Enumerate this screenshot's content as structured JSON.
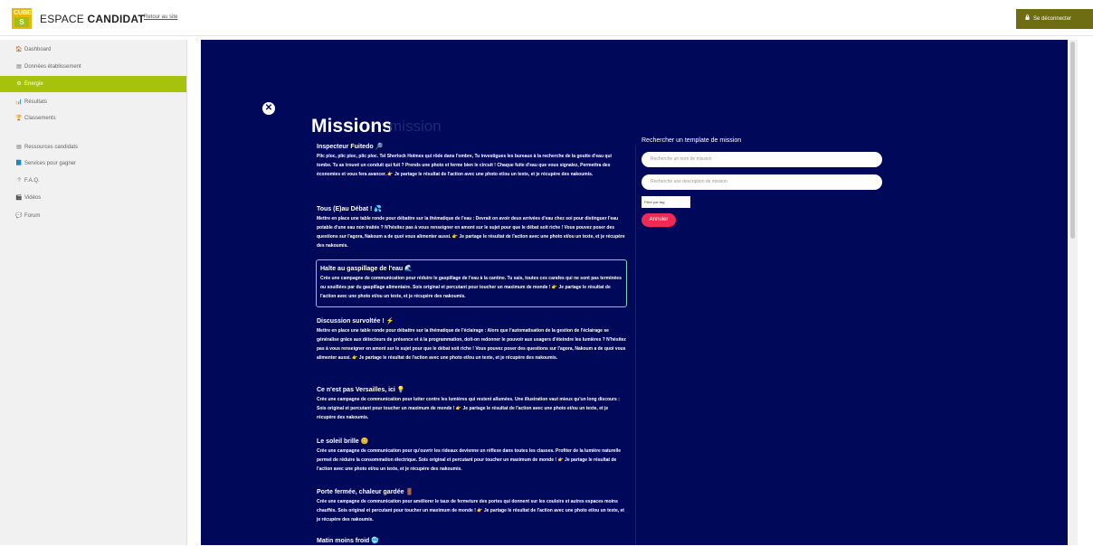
{
  "header": {
    "logo_top": "CUBE",
    "logo_bottom": "S",
    "brand_light": "ESPACE ",
    "brand_bold": "CANDIDAT",
    "back_link": "Retour au site",
    "logout_label": "Se déconnecter"
  },
  "sidebar": {
    "items": [
      {
        "icon": "🏠",
        "label": "Dashboard"
      },
      {
        "icon": "▤",
        "label": "Données établissement"
      },
      {
        "icon": "⚙",
        "label": "Energie"
      },
      {
        "icon": "📊",
        "label": "Résultats"
      },
      {
        "icon": "🏆",
        "label": "Classements"
      },
      {
        "icon": "▤",
        "label": "Ressources candidats"
      },
      {
        "icon": "📘",
        "label": "Services pour gagner"
      },
      {
        "icon": "?",
        "label": "F.A.Q."
      },
      {
        "icon": "🎬",
        "label": "Vidéos"
      },
      {
        "icon": "💬",
        "label": "Forum"
      }
    ]
  },
  "main": {
    "close": "✕",
    "title": "Missions",
    "title_ghost": "mission",
    "missions": [
      {
        "title": "Inspecteur Fuitedo 🔎",
        "desc": "Plic ploc, plic ploc, plic ploc. Tel Sherlock Holmes qui rôde dans l'ombre, Tu investigues les bureaux à la recherche de la goutte d'eau qui tombe. Tu as trouvé un conduit qui fuit ? Prends une photo et ferme bien le circuit ! Chaque fuite d'eau que vous signalez, Permettra des économies et vous fera avancer. 👉 Je partage le résultat de l'action avec une photo et/ou un texte, et je récupère des nakoumis."
      },
      {
        "title": "Tous (E)au Débat ! 💦",
        "desc": "Mettre en place une table ronde pour débattre sur la thématique de l'eau : Devrait on avoir deux arrivées d'eau chez soi pour distinguer l'eau potable d'une eau non traitée ? N'hésitez pas à vous renseigner en amont sur le sujet pour que le débat soit riche ! Vous pouvez poser des questions sur l'agora, Nakoum a de quoi vous alimenter aussi. 👉 Je partage le résultat de l'action avec une photo et/ou un texte, et je récupère des nakoumis."
      },
      {
        "title": "Halte au gaspillage de l'eau 🌊",
        "desc": "Crée une campagne de communication pour réduire le gaspillage de l'eau à la cantine. Tu sais, toutes ces carafes qui ne sont pas terminées ou souillées par du gaspillage alimentaire. Sois original et percutant pour toucher un maximum de monde ! 👉 Je partage le résultat de l'action avec une photo et/ou un texte, et je récupère des nakoumis."
      },
      {
        "title": "Discussion survoltée ! ⚡",
        "desc": "Mettre en place une table ronde pour débattre sur la thématique de l'éclairage : Alors que l'automatisation de la gestion de l'éclairage se généralise grâce aux détecteurs de présence et à la programmation, doit-on redonner le pouvoir aux usagers d'éteindre les lumières ? N'hésitez pas à vous renseigner en amont sur le sujet pour que le débat soit riche ! Vous pouvez poser des questions sur l'agora, Nakoum a de quoi vous alimenter aussi. 👉 Je partage le résultat de l'action avec une photo et/ou un texte, et je récupère des nakoumis."
      },
      {
        "title": "Ce n'est pas Versailles, ici 💡",
        "desc": "Crée une campagne de communication pour lutter contre les lumières qui restent allumées. Une illustration vaut mieux qu'un long discours : Sois original et percutant pour toucher un maximum de monde ! 👉 Je partage le résultat de l'action avec une photo et/ou un texte, et je récupère des nakoumis."
      },
      {
        "title": "Le soleil brille 😊",
        "desc": "Crée une campagne de communication pour qu'ouvrir les rideaux devienne un réflexe dans toutes les classes. Profiter de la lumière naturelle permet de réduire la consommation électrique. Sois original et percutant pour toucher un maximum de monde ! 👉 Je partage le résultat de l'action avec une photo et/ou un texte, et je récupère des nakoumis."
      },
      {
        "title": "Porte fermée, chaleur gardée 🚪",
        "desc": "Crée une campagne de communication pour améliorer le taux de fermeture des portes qui donnent sur les couloirs et autres espaces moins chauffés. Sois original et percutant pour toucher un maximum de monde ! 👉 Je partage le résultat de l'action avec une photo et/ou un texte, et je récupère des nakoumis."
      },
      {
        "title": "Matin moins froid 🥶",
        "desc": ""
      }
    ]
  },
  "search": {
    "title": "Rechercher un template de mission",
    "name_placeholder": "Recherche un nom de mission",
    "desc_placeholder": "Recherche une description de mission",
    "filter_label": "Filtre par tag",
    "cancel_label": "Annuler"
  }
}
